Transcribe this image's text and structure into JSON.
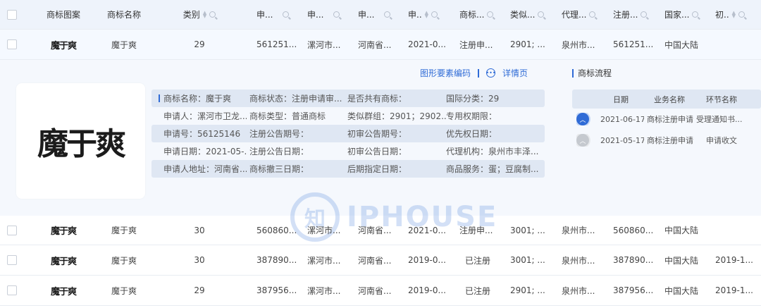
{
  "columns": {
    "logo": "商标图案",
    "name": "商标名称",
    "cls": "类别",
    "a": "申...",
    "b": "申...",
    "c": "申...",
    "d": "申..",
    "e": "商标...",
    "f": "类似...",
    "g": "代理...",
    "h": "注册...",
    "i": "国家...",
    "j": "初.."
  },
  "rows": [
    {
      "logo": "魔于爽",
      "name": "魔于爽",
      "cls": "29",
      "a": "561251...",
      "b": "漯河市...",
      "c": "河南省...",
      "d": "2021-0...",
      "e": "注册申...",
      "f": "2901; ...",
      "g": "泉州市...",
      "h": "561251...",
      "i": "中国大陆",
      "j": ""
    },
    {
      "logo": "魔于爽",
      "name": "魔于爽",
      "cls": "30",
      "a": "560860...",
      "b": "漯河市...",
      "c": "河南省...",
      "d": "2021-0...",
      "e": "注册申...",
      "f": "3001; ...",
      "g": "泉州市...",
      "h": "560860...",
      "i": "中国大陆",
      "j": ""
    },
    {
      "logo": "魔于爽",
      "name": "魔于爽",
      "cls": "30",
      "a": "387890...",
      "b": "漯河市...",
      "c": "河南省...",
      "d": "2019-0...",
      "e": "已注册",
      "f": "3001; ...",
      "g": "泉州市...",
      "h": "387890...",
      "i": "中国大陆",
      "j": "2019-1..."
    },
    {
      "logo": "魔于爽",
      "name": "魔于爽",
      "cls": "29",
      "a": "387956...",
      "b": "漯河市...",
      "c": "河南省...",
      "d": "2019-0...",
      "e": "已注册",
      "f": "2901; ...",
      "g": "泉州市...",
      "h": "387956...",
      "i": "中国大陆",
      "j": "2019-1..."
    }
  ],
  "detail": {
    "big_logo": "魔于爽",
    "link_code": "图形要素编码",
    "link_detail": "详情页",
    "flow_title": "商标流程",
    "info": [
      [
        "商标名称：魔于爽",
        "商标状态：注册申请审...",
        "是否共有商标：",
        "国际分类：29"
      ],
      [
        "申请人：漯河市卫龙...",
        "商标类型：普通商标",
        "类似群组：2901；2902...",
        "专用权期限："
      ],
      [
        "申请号：56125146",
        "注册公告期号：",
        "初审公告期号：",
        "优先权日期："
      ],
      [
        "申请日期：2021-05-...",
        "注册公告日期：",
        "初审公告日期：",
        "代理机构：泉州市丰泽..."
      ],
      [
        "申请人地址：河南省...",
        "商标撤三日期：",
        "后期指定日期：",
        "商品服务：蛋；豆腐制..."
      ]
    ],
    "flow_head": [
      "日期",
      "业务名称",
      "环节名称"
    ],
    "flow_rows": [
      [
        "2021-06-17",
        "商标注册申请",
        "受理通知书..."
      ],
      [
        "2021-05-17",
        "商标注册申请",
        "申请收文"
      ]
    ]
  },
  "watermark": {
    "mark": "知",
    "text": "IPHOUSE"
  }
}
